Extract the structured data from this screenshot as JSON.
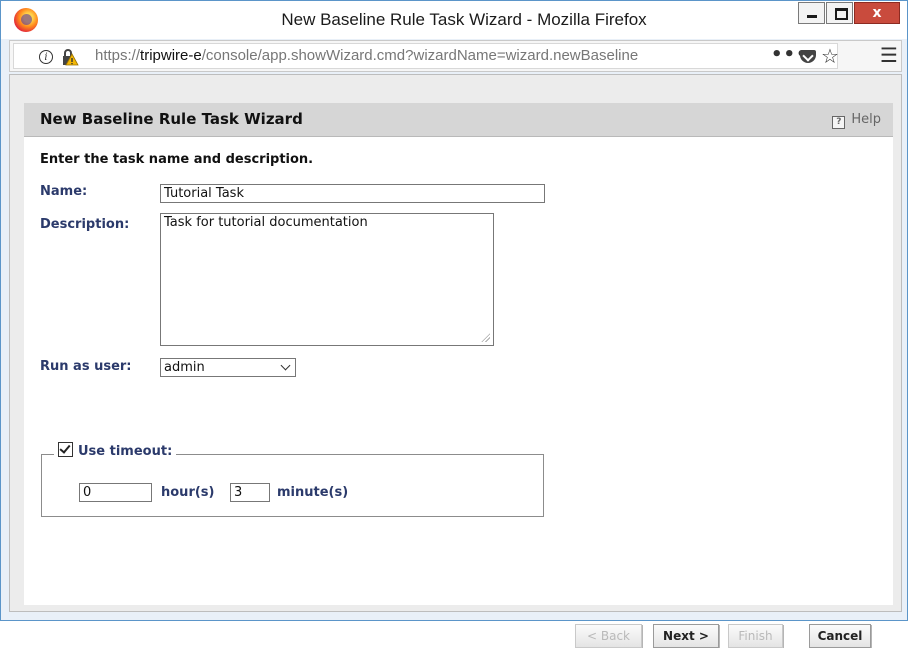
{
  "window": {
    "title": "New Baseline Rule Task Wizard - Mozilla Firefox",
    "minimize_label": "",
    "close_label": "x"
  },
  "browser": {
    "url_prefix": "https://",
    "url_host": "tripwire-e",
    "url_path": "/console/app.showWizard.cmd?wizardName=wizard.newBaseline",
    "more_label": "•••",
    "menu_label": "☰"
  },
  "wizard": {
    "title": "New Baseline Rule Task Wizard",
    "help_label": "Help",
    "instruction": "Enter the task name and description.",
    "name_label": "Name:",
    "name_value": "Tutorial Task",
    "description_label": "Description:",
    "description_value": "Task for tutorial documentation",
    "run_as_label": "Run as user:",
    "run_as_value": "admin",
    "use_timeout_label": "Use timeout:",
    "use_timeout_checked": true,
    "hours_value": "0",
    "hours_label": "hour(s)",
    "minutes_value": "3",
    "minutes_label": "minute(s)"
  },
  "buttons": {
    "back": "< Back",
    "next": "Next >",
    "finish": "Finish",
    "cancel": "Cancel"
  }
}
